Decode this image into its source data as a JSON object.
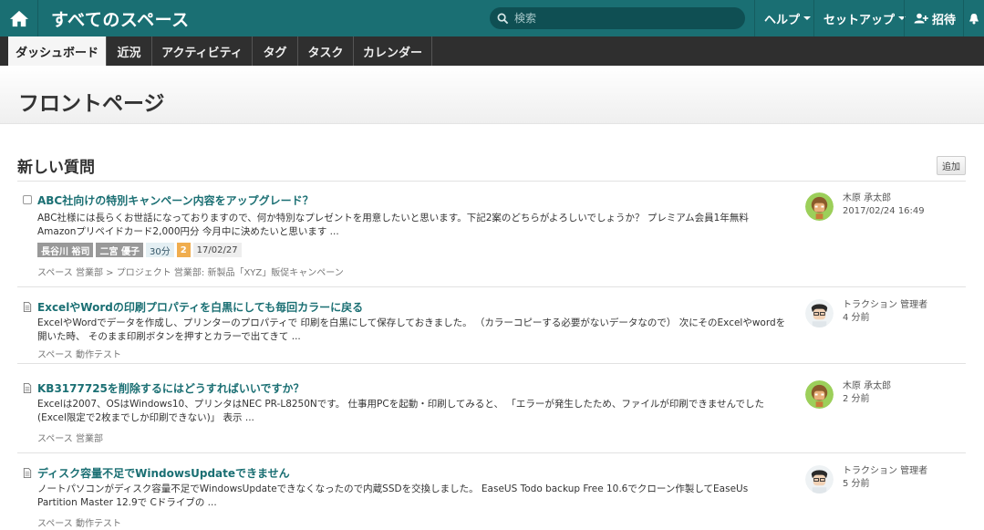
{
  "header": {
    "title": "すべてのスペース",
    "search_placeholder": "検索",
    "help_label": "ヘルプ",
    "setup_label": "セットアップ",
    "invite_label": "招待"
  },
  "tabs": [
    {
      "label": "ダッシュボード"
    },
    {
      "label": "近況"
    },
    {
      "label": "アクティビティ"
    },
    {
      "label": "タグ"
    },
    {
      "label": "タスク"
    },
    {
      "label": "カレンダー"
    }
  ],
  "page": {
    "title": "フロントページ",
    "section_title": "新しい質問",
    "add_label": "追加"
  },
  "items": [
    {
      "title": "ABC社向けの特別キャンペーン内容をアップグレード？",
      "body": "ABC社様には長らくお世話になっておりますので、何か特別なプレゼントを用意したいと思います。下記2案のどちらがよろしいでしょうか？ プレミアム会員1年無料 Amazonプリペイドカード2,000円分 今月中に決めたいと思います ...",
      "tags": [
        "長谷川 裕司",
        "二宮 優子"
      ],
      "time": "30分",
      "count": "2",
      "date": "17/02/27",
      "space": "スペース 営業部 > プロジェクト 営業部: 新製品「XYZ」販促キャンペーン",
      "author": "木原 承太郎",
      "when": "2017/02/24 16:49"
    },
    {
      "title": "ExcelやWordの印刷プロパティを白黒にしても毎回カラーに戻る",
      "body": "ExcelやWordでデータを作成し、プリンターのプロパティで 印刷を白黒にして保存しておきました。 （カラーコピーする必要がないデータなので） 次にそのExcelやwordを開いた時、 そのまま印刷ボタンを押すとカラーで出てきて ...",
      "space": "スペース 動作テスト",
      "author": "トラクション 管理者",
      "when": "4 分前"
    },
    {
      "title": "KB3177725を削除するにはどうすればいいですか？",
      "body": "Excelは2007、OSはWindows10、プリンタはNEC PR-L8250Nです。 仕事用PCを起動・印刷してみると、 「エラーが発生したため、ファイルが印刷できませんでした(Excel限定で2枚までしか印刷できない)」 表示 ...",
      "space": "スペース 営業部",
      "author": "木原 承太郎",
      "when": "2 分前"
    },
    {
      "title": "ディスク容量不足でWindowsUpdateできません",
      "body": "ノートパソコンがディスク容量不足でWindowsUpdateできなくなったので内蔵SSDを交換しました。 EaseUS Todo backup Free 10.6でクローン作製してEaseUs Partition Master 12.9で Cドライブの ...",
      "space": "スペース 動作テスト",
      "author": "トラクション 管理者",
      "when": "5 分前"
    }
  ]
}
